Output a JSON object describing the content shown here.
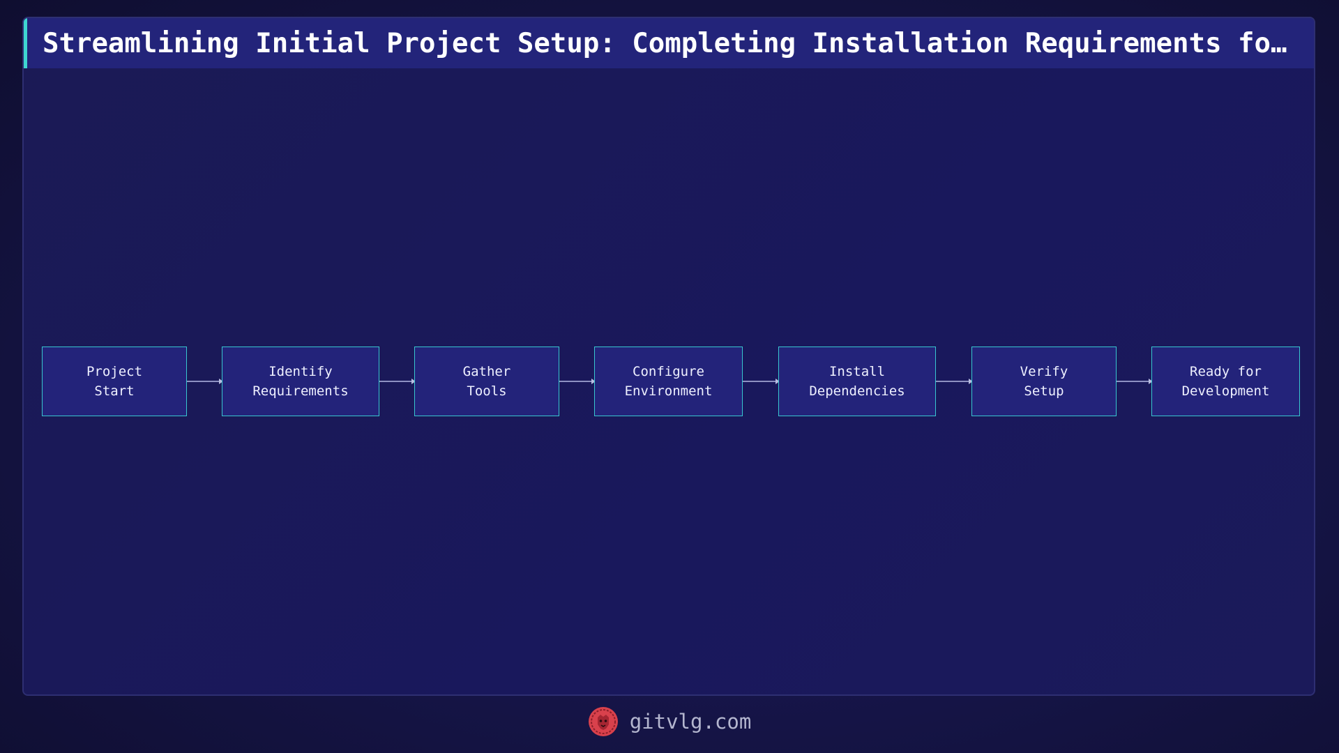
{
  "header": {
    "title": "Streamlining Initial Project Setup: Completing Installation Requirements for pr…"
  },
  "diagram": {
    "type": "flowchart",
    "direction": "left-to-right",
    "nodes": [
      {
        "id": "project-start",
        "label": "Project\nStart"
      },
      {
        "id": "identify-requirements",
        "label": "Identify\nRequirements"
      },
      {
        "id": "gather-tools",
        "label": "Gather\nTools"
      },
      {
        "id": "configure-environment",
        "label": "Configure\nEnvironment"
      },
      {
        "id": "install-dependencies",
        "label": "Install\nDependencies"
      },
      {
        "id": "verify-setup",
        "label": "Verify\nSetup"
      },
      {
        "id": "ready-for-development",
        "label": "Ready for\nDevelopment"
      }
    ],
    "edges": [
      {
        "from": "project-start",
        "to": "identify-requirements"
      },
      {
        "from": "identify-requirements",
        "to": "gather-tools"
      },
      {
        "from": "gather-tools",
        "to": "configure-environment"
      },
      {
        "from": "configure-environment",
        "to": "install-dependencies"
      },
      {
        "from": "install-dependencies",
        "to": "verify-setup"
      },
      {
        "from": "verify-setup",
        "to": "ready-for-development"
      }
    ]
  },
  "footer": {
    "logo_icon": "lion-head-icon",
    "site": "gitvlg.com"
  },
  "colors": {
    "background": "#151445",
    "title_bar": "#23247a",
    "accent": "#3ed6d0",
    "node_fill": "#23237a",
    "node_border": "#38c7d0",
    "logo": "#d9414c"
  }
}
